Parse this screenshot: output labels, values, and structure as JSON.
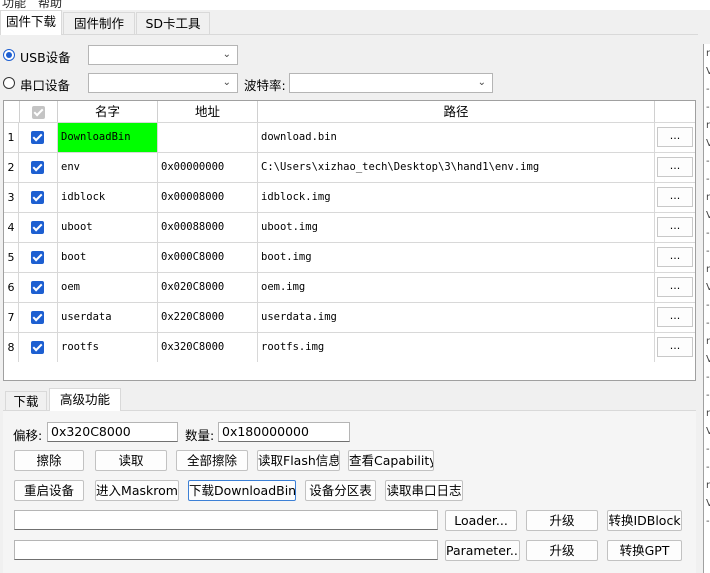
{
  "menu": {
    "items": [
      "功能",
      "帮助"
    ]
  },
  "main_tabs": [
    "固件下载",
    "固件制作",
    "SD卡工具"
  ],
  "device": {
    "usb_label": "USB设备",
    "serial_label": "串口设备",
    "baud_label": "波特率:"
  },
  "table": {
    "headers": [
      "名字",
      "地址",
      "路径"
    ],
    "rows": [
      {
        "num": "1",
        "name": "DownloadBin",
        "address": "",
        "path": "download.bin",
        "button": "..."
      },
      {
        "num": "2",
        "name": "env",
        "address": "0x00000000",
        "path": "C:\\Users\\xizhao_tech\\Desktop\\3\\hand1\\env.img",
        "button": "..."
      },
      {
        "num": "3",
        "name": "idblock",
        "address": "0x00008000",
        "path": "idblock.img",
        "button": "..."
      },
      {
        "num": "4",
        "name": "uboot",
        "address": "0x00088000",
        "path": "uboot.img",
        "button": "..."
      },
      {
        "num": "5",
        "name": "boot",
        "address": "0x000C8000",
        "path": "boot.img",
        "button": "..."
      },
      {
        "num": "6",
        "name": "oem",
        "address": "0x020C8000",
        "path": "oem.img",
        "button": "..."
      },
      {
        "num": "7",
        "name": "userdata",
        "address": "0x220C8000",
        "path": "userdata.img",
        "button": "..."
      },
      {
        "num": "8",
        "name": "rootfs",
        "address": "0x320C8000",
        "path": "rootfs.img",
        "button": "..."
      }
    ],
    "highlight_color": "#00ff00"
  },
  "sub_tabs": [
    "下载",
    "高级功能"
  ],
  "advanced": {
    "offset_label": "偏移:",
    "offset_value": "0x320C8000",
    "count_label": "数量:",
    "count_value": "0x180000000",
    "row1_buttons": [
      "擦除",
      "读取",
      "全部擦除",
      "读取Flash信息",
      "查看Capability"
    ],
    "row2_buttons": [
      "重启设备",
      "进入Maskrom",
      "下载DownloadBin",
      "设备分区表",
      "读取串口日志"
    ],
    "loader_button": "Loader...",
    "parameter_button": "Parameter...",
    "upgrade_label": "升级",
    "convert_idblock": "转换IDBlock",
    "convert_gpt": "转换GPT"
  },
  "log_panel": {
    "fragments": [
      "r",
      "V",
      "-",
      "-",
      "r",
      "V",
      "-",
      "-",
      "r",
      "V",
      "-",
      "-",
      "r",
      "V",
      "-",
      "-",
      "r",
      "V",
      "-",
      "-",
      "r",
      "V",
      "-",
      "-",
      "r",
      "V",
      "-"
    ]
  },
  "colors": {
    "accent": "#1d5fd1"
  }
}
